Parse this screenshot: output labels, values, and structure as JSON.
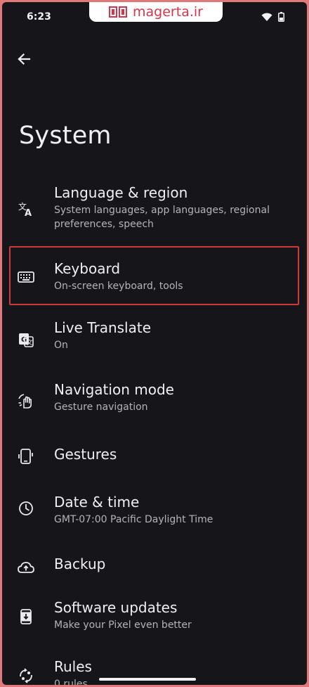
{
  "status_bar": {
    "time": "6:23",
    "watermark": "magerta.ir"
  },
  "header": {
    "title": "System"
  },
  "items": [
    {
      "title": "Language & region",
      "subtitle": "System languages, app languages, regional preferences, speech",
      "icon": "translate-icon"
    },
    {
      "title": "Keyboard",
      "subtitle": "On-screen keyboard, tools",
      "icon": "keyboard-icon",
      "highlighted": true
    },
    {
      "title": "Live Translate",
      "subtitle": "On",
      "icon": "live-translate-icon"
    },
    {
      "title": "Navigation mode",
      "subtitle": "Gesture navigation",
      "icon": "gesture-hand-icon"
    },
    {
      "title": "Gestures",
      "subtitle": "",
      "icon": "phone-gesture-icon"
    },
    {
      "title": "Date & time",
      "subtitle": "GMT-07:00 Pacific Daylight Time",
      "icon": "clock-icon"
    },
    {
      "title": "Backup",
      "subtitle": "",
      "icon": "cloud-upload-icon"
    },
    {
      "title": "Software updates",
      "subtitle": "Make your Pixel even better",
      "icon": "system-update-icon"
    },
    {
      "title": "Rules",
      "subtitle": "0 rules",
      "icon": "rules-icon"
    }
  ],
  "colors": {
    "background": "#16161a",
    "frame": "#e07a7a",
    "highlight_border": "#d23a3a",
    "watermark_text": "#d6344a"
  }
}
